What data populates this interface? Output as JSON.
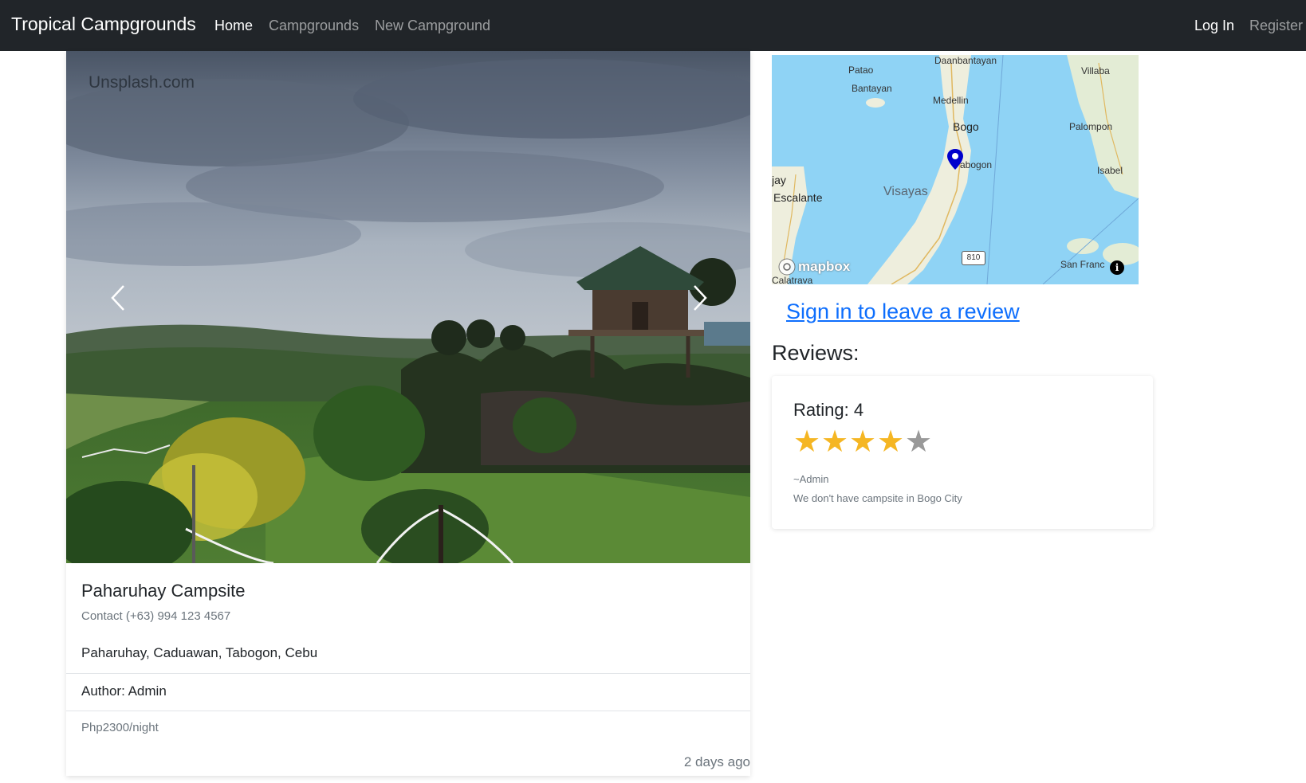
{
  "navbar": {
    "brand": "Tropical Campgrounds",
    "links": [
      {
        "label": "Home",
        "active": true
      },
      {
        "label": "Campgrounds",
        "active": false
      },
      {
        "label": "New Campground",
        "active": false
      }
    ],
    "auth": [
      {
        "label": "Log In"
      },
      {
        "label": "Register"
      }
    ]
  },
  "carousel": {
    "watermark": "Unsplash.com",
    "prev_icon": "chevron-left-icon",
    "next_icon": "chevron-right-icon"
  },
  "campground": {
    "title": "Paharuhay Campsite",
    "contact": "Contact (+63) 994 123 4567",
    "location": "Paharuhay, Caduawan, Tabogon, Cebu",
    "author": "Author: Admin",
    "price": "Php2300/night",
    "posted": "2 days ago"
  },
  "map": {
    "labels": {
      "daanbantayan": "Daanbantayan",
      "villaba": "Villaba",
      "patao": "Patao",
      "bantayan": "Bantayan",
      "medellin": "Medellin",
      "bogo": "Bogo",
      "palompon": "Palompon",
      "tabogon": "abogon",
      "isabel": "Isabel",
      "gay": "jay",
      "escalante": "Escalante",
      "visayas": "Visayas",
      "highway": "810",
      "san_franc": "San Franc",
      "calatrava": "Calatrava"
    },
    "logo": "mapbox",
    "info_icon": "info-icon",
    "marker_icon": "map-marker-icon",
    "marker_color": "#0000cc"
  },
  "reviews": {
    "sign_in_link": "Sign in to leave a review",
    "heading": "Reviews:",
    "items": [
      {
        "rating_label": "Rating: 4",
        "rating": 4,
        "max_rating": 5,
        "author": "~Admin",
        "text": "We don't have campsite in Bogo City"
      }
    ]
  },
  "colors": {
    "navbar_bg": "#212529",
    "link": "#0d6efd",
    "star_filled": "#f5b623",
    "star_empty": "#999999"
  }
}
